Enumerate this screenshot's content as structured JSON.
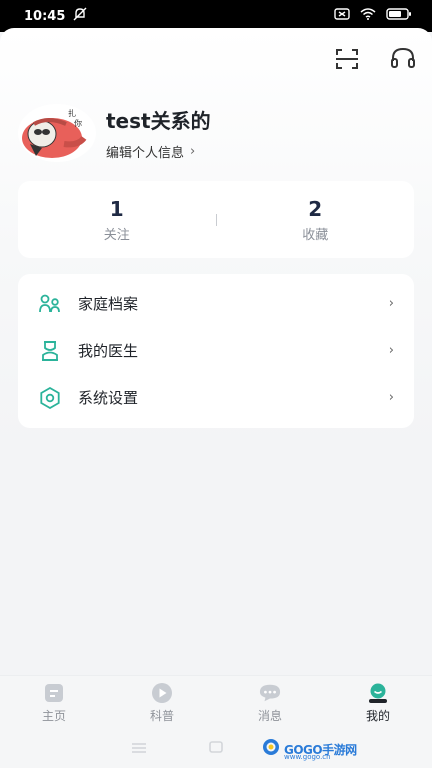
{
  "status_bar": {
    "time": "10:45"
  },
  "profile": {
    "name": "test关系的",
    "edit_label": "编辑个人信息"
  },
  "stats": [
    {
      "value": "1",
      "label": "关注"
    },
    {
      "value": "2",
      "label": "收藏"
    }
  ],
  "menu": {
    "items": [
      {
        "label": "家庭档案",
        "icon": "family-profile-icon"
      },
      {
        "label": "我的医生",
        "icon": "doctor-icon"
      },
      {
        "label": "系统设置",
        "icon": "gear-icon"
      }
    ]
  },
  "bottom_nav": {
    "items": [
      {
        "label": "主页",
        "icon": "home-icon",
        "active": false
      },
      {
        "label": "科普",
        "icon": "play-icon",
        "active": false
      },
      {
        "label": "消息",
        "icon": "chat-icon",
        "active": false
      },
      {
        "label": "我的",
        "icon": "user-icon",
        "active": true
      }
    ]
  },
  "watermark": {
    "text": "GOGO手游网",
    "sub": "www.gogo.cn"
  },
  "colors": {
    "accent": "#2bb39a",
    "nav_inactive": "#c8ccd2",
    "text_primary": "#1f2329",
    "stat_number": "#1f2a44"
  }
}
